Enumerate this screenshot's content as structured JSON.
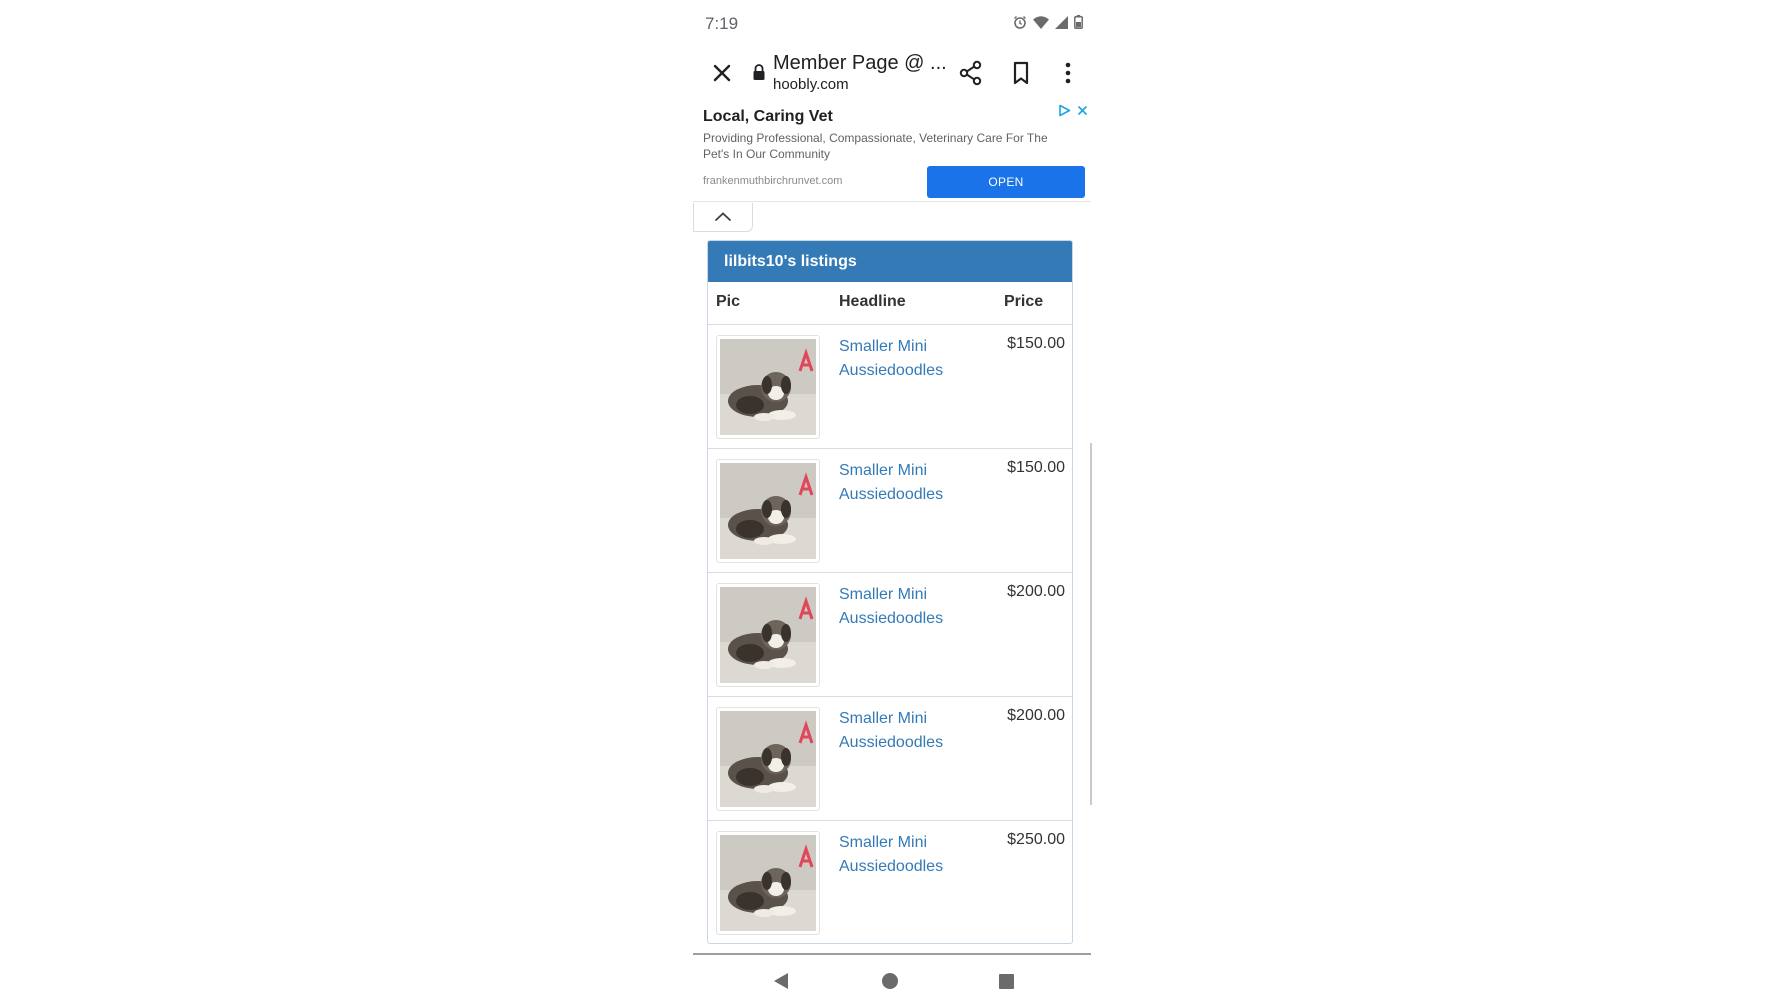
{
  "status_bar": {
    "time": "7:19",
    "icons": [
      "alarm-icon",
      "wifi-icon",
      "signal-icon",
      "battery-icon"
    ]
  },
  "toolbar": {
    "title": "Member Page @ ...",
    "domain": "hoobly.com",
    "icons": [
      "close-icon",
      "lock-icon",
      "share-icon",
      "bookmark-icon",
      "more-vert-icon"
    ]
  },
  "ad": {
    "title": "Local, Caring Vet",
    "description": "Providing Professional, Compassionate, Veterinary Care For The Pet's In Our Community",
    "url": "frankenmuthbirchrunvet.com",
    "button_label": "OPEN",
    "accent_color": "#1a73e8"
  },
  "listings": {
    "heading": "lilbits10's listings",
    "header_color": "#337ab7",
    "columns": {
      "pic": "Pic",
      "headline": "Headline",
      "price": "Price"
    },
    "rows": [
      {
        "headline": "Smaller Mini Aussiedoodles",
        "price": "$150.00"
      },
      {
        "headline": "Smaller Mini Aussiedoodles",
        "price": "$150.00"
      },
      {
        "headline": "Smaller Mini Aussiedoodles",
        "price": "$200.00"
      },
      {
        "headline": "Smaller Mini Aussiedoodles",
        "price": "$200.00"
      },
      {
        "headline": "Smaller Mini Aussiedoodles",
        "price": "$250.00"
      }
    ]
  },
  "nav_bar": {
    "icons": [
      "back-icon",
      "home-icon",
      "recents-icon"
    ]
  }
}
